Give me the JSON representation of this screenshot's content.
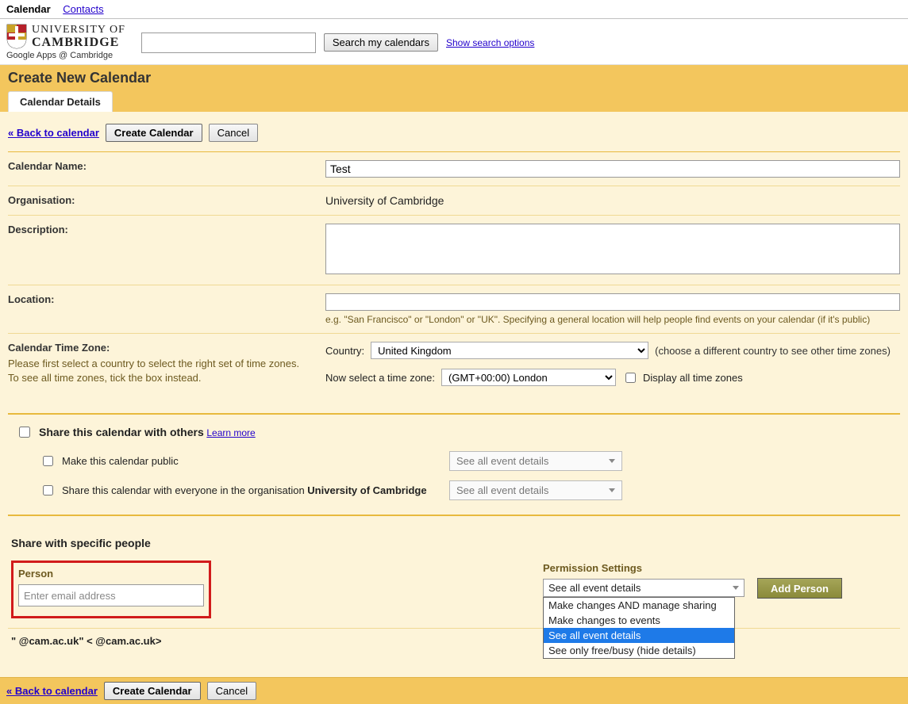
{
  "topnav": {
    "calendar": "Calendar",
    "contacts": "Contacts"
  },
  "header": {
    "org_line1": "UNIVERSITY OF",
    "org_line2": "CAMBRIDGE",
    "sub": "Google Apps @ Cambridge",
    "search_button": "Search my calendars",
    "show_search_options": "Show search options"
  },
  "page": {
    "title": "Create New Calendar",
    "tab": "Calendar Details",
    "back": "« Back to calendar",
    "create_btn": "Create Calendar",
    "cancel_btn": "Cancel"
  },
  "form": {
    "name_label": "Calendar Name:",
    "name_value": "Test",
    "org_label": "Organisation:",
    "org_value": "University of Cambridge",
    "desc_label": "Description:",
    "desc_value": "",
    "loc_label": "Location:",
    "loc_value": "",
    "loc_hint": "e.g. \"San Francisco\" or \"London\" or \"UK\". Specifying a general location will help people find events on your calendar (if it's public)",
    "tz_label": "Calendar Time Zone:",
    "tz_sub": "Please first select a country to select the right set of time zones. To see all time zones, tick the box instead.",
    "country_label": "Country:",
    "country_value": "United Kingdom",
    "country_hint": "(choose a different country to see other time zones)",
    "tz_row_label": "Now select a time zone:",
    "tz_value": "(GMT+00:00) London",
    "tz_all": "Display all time zones"
  },
  "share": {
    "title": "Share this calendar with others",
    "learn_more": "Learn more",
    "public_label": "Make this calendar public",
    "org_share_prefix": "Share this calendar with everyone in the organisation ",
    "org_share_org": "University of Cambridge",
    "dropdown_label": "See all event details"
  },
  "people": {
    "title": "Share with specific people",
    "person_col": "Person",
    "perm_col": "Permission Settings",
    "email_placeholder": "Enter email address",
    "perm_selected": "See all event details",
    "perm_options": [
      "Make changes AND manage sharing",
      "Make changes to events",
      "See all event details",
      "See only free/busy (hide details)"
    ],
    "add_btn": "Add Person",
    "entry_text": "\"        @cam.ac.uk\" <        @cam.ac.uk>"
  }
}
